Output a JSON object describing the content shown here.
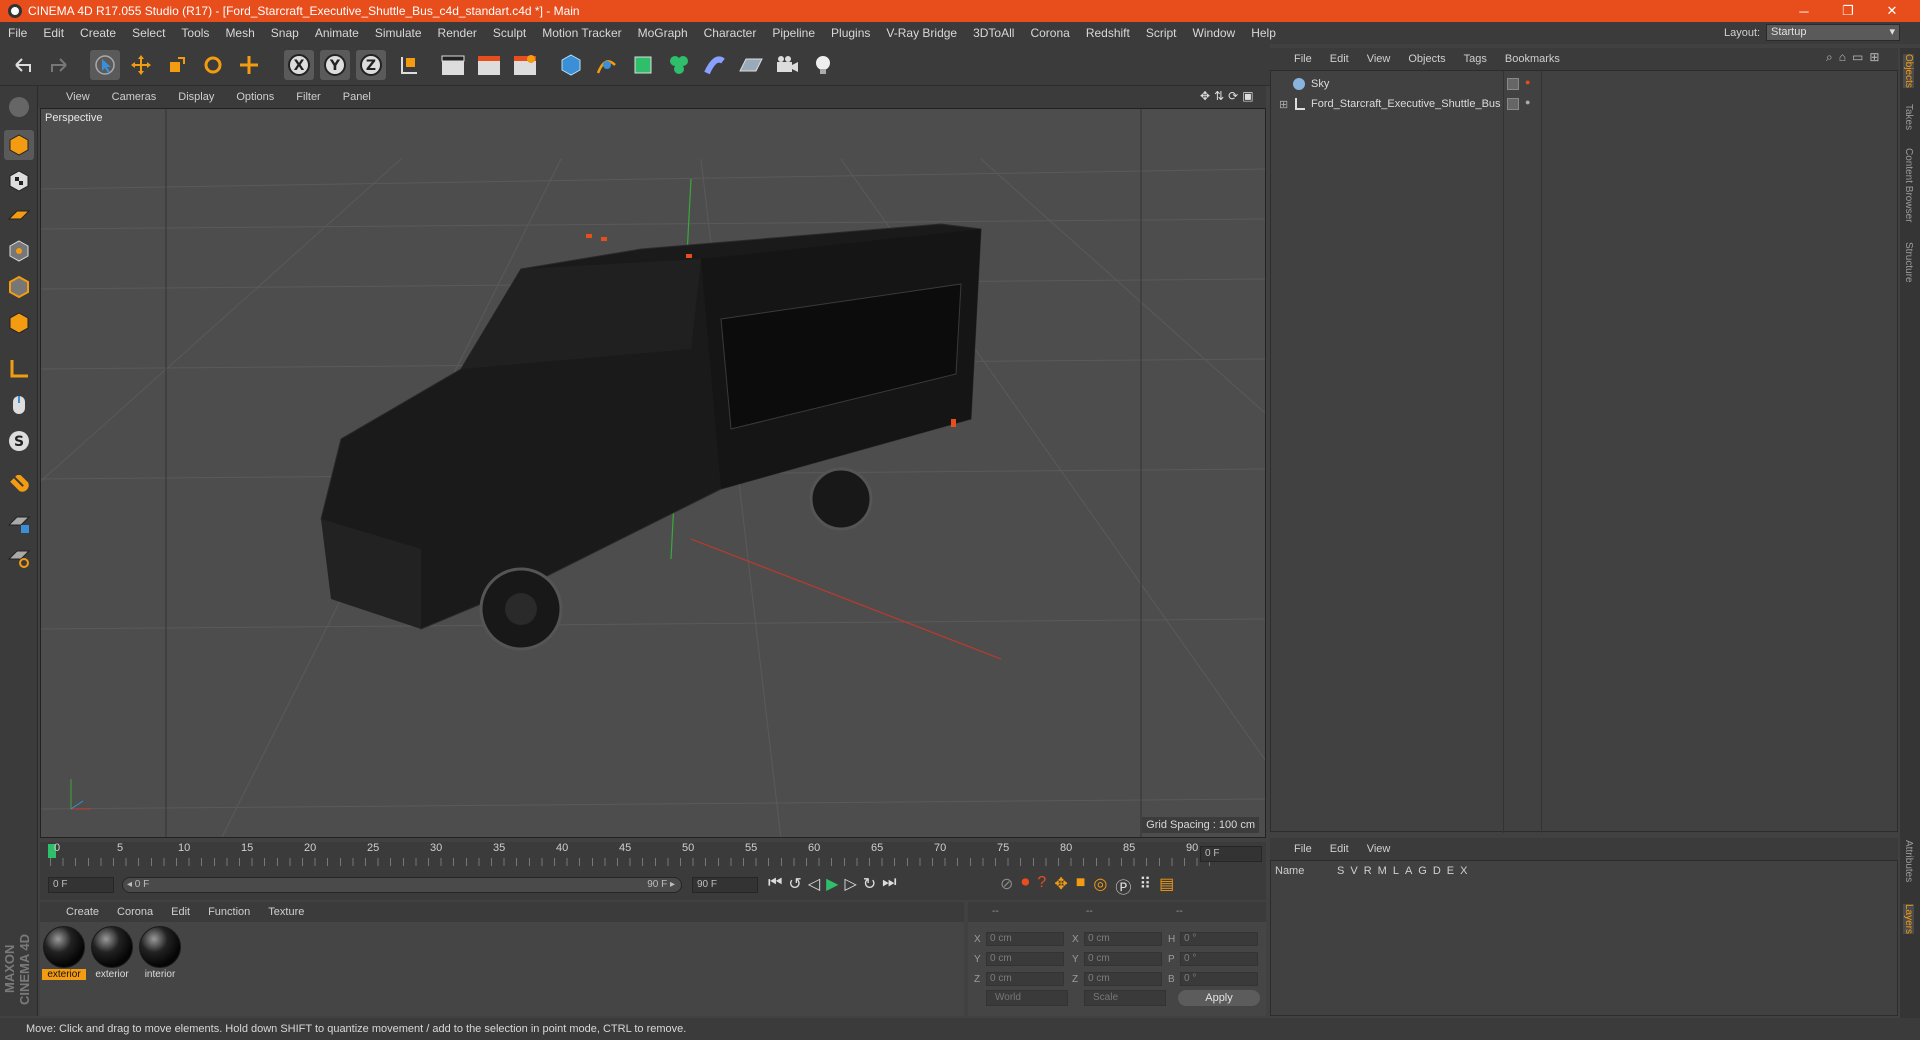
{
  "window": {
    "title": "CINEMA 4D R17.055 Studio (R17) - [Ford_Starcraft_Executive_Shuttle_Bus_c4d_standart.c4d *] - Main",
    "minimize": "─",
    "maximize": "❐",
    "close": "✕"
  },
  "menu": [
    "File",
    "Edit",
    "Create",
    "Select",
    "Tools",
    "Mesh",
    "Snap",
    "Animate",
    "Simulate",
    "Render",
    "Sculpt",
    "Motion Tracker",
    "MoGraph",
    "Character",
    "Pipeline",
    "Plugins",
    "V-Ray Bridge",
    "3DToAll",
    "Corona",
    "Redshift",
    "Script",
    "Window",
    "Help"
  ],
  "layout": {
    "label": "Layout:",
    "value": "Startup"
  },
  "viewport": {
    "menu": [
      "View",
      "Cameras",
      "Display",
      "Options",
      "Filter",
      "Panel"
    ],
    "label": "Perspective",
    "grid_spacing": "Grid Spacing : 100 cm"
  },
  "timeline": {
    "ticks": [
      "0",
      "5",
      "10",
      "15",
      "20",
      "25",
      "30",
      "35",
      "40",
      "45",
      "50",
      "55",
      "60",
      "65",
      "70",
      "75",
      "80",
      "85",
      "90"
    ],
    "end_frame": "0 F"
  },
  "transport": {
    "start_field": "0 F",
    "range_start": "◂ 0 F",
    "range_end": "90 F ▸",
    "end_field": "90 F"
  },
  "materials": {
    "menu": [
      "Create",
      "Corona",
      "Edit",
      "Function",
      "Texture"
    ],
    "items": [
      {
        "label": "exterior",
        "selected": true
      },
      {
        "label": "exterior",
        "selected": false
      },
      {
        "label": "interior",
        "selected": false
      }
    ]
  },
  "coordinates": {
    "headers": [
      "--",
      "--",
      "--"
    ],
    "rows": [
      {
        "a": "X",
        "a_val": "0 cm",
        "b": "X",
        "b_val": "0 cm",
        "c": "H",
        "c_val": "0 °"
      },
      {
        "a": "Y",
        "a_val": "0 cm",
        "b": "Y",
        "b_val": "0 cm",
        "c": "P",
        "c_val": "0 °"
      },
      {
        "a": "Z",
        "a_val": "0 cm",
        "b": "Z",
        "b_val": "0 cm",
        "c": "B",
        "c_val": "0 °"
      }
    ],
    "mode_world": "World",
    "mode_scale": "Scale",
    "apply": "Apply"
  },
  "objects": {
    "menu": [
      "File",
      "Edit",
      "View",
      "Objects",
      "Tags",
      "Bookmarks"
    ],
    "items": [
      {
        "name": "Sky"
      },
      {
        "name": "Ford_Starcraft_Executive_Shuttle_Bus"
      }
    ]
  },
  "attributes": {
    "menu": [
      "File",
      "Edit",
      "View"
    ],
    "columns": [
      "Name",
      "S",
      "V",
      "R",
      "M",
      "L",
      "A",
      "G",
      "D",
      "E",
      "X"
    ]
  },
  "side_tabs": [
    "Objects",
    "Takes",
    "Content Browser",
    "Structure",
    "Attributes",
    "Layers"
  ],
  "status": "Move: Click and drag to move elements. Hold down SHIFT to quantize movement / add to the selection in point mode, CTRL to remove.",
  "brand": "MAXON CINEMA 4D",
  "colors": {
    "accent": "#e84d1c",
    "selection": "#f39c12",
    "tool_blue": "#3a8fd6"
  }
}
